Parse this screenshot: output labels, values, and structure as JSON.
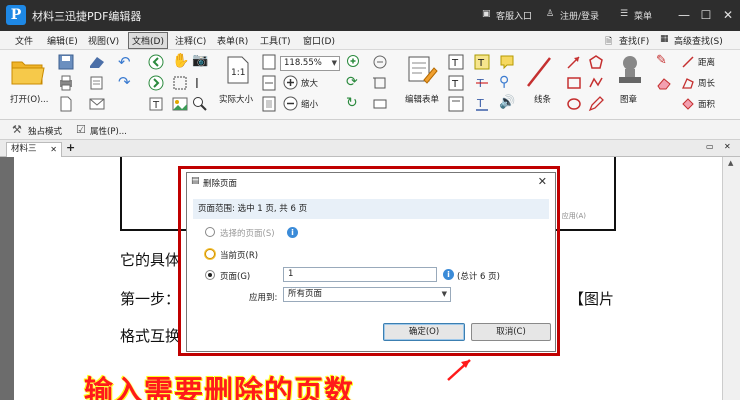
{
  "app": {
    "title": "材料三迅捷PDF编辑器",
    "logo_letter": "P",
    "service": "客服入口",
    "login": "注册/登录",
    "menu": "菜单"
  },
  "menubar": {
    "items": [
      "文件",
      "编辑(E)",
      "视图(V)",
      "文档(D)",
      "注释(C)",
      "表单(R)",
      "工具(T)",
      "窗口(D)"
    ],
    "active_index": 3,
    "find": "查找(F)",
    "advanced_find": "高级查找(S)"
  },
  "ribbon": {
    "open": "打开(O)...",
    "actual_size": "实际大小",
    "zoom_value": "118.55%",
    "zoom_in": "放大",
    "zoom_out": "缩小",
    "edit_form": "编辑表单",
    "lines": "线条",
    "stamp": "图章",
    "distance": "距离",
    "perimeter": "周长",
    "area": "面积"
  },
  "subtoolbar": {
    "exclusive_mode": "独占模式",
    "properties": "属性(P)..."
  },
  "tabs": {
    "doc_tab": "材料三"
  },
  "document": {
    "line1": "它的具体",
    "line2": "第一步：",
    "line2_right": "【图片",
    "line3": "格式互换",
    "apply_hint": "应用(A)"
  },
  "dialog": {
    "title": "删除页面",
    "range_text": "页面范围: 选中 1 页, 共 6 页",
    "opt_selected": "选择的页面(S)",
    "opt_current": "当前页(R)",
    "opt_pages": "页面(G)",
    "pages_value": "1",
    "total_text": "(总计 6 页)",
    "apply_to_label": "应用到:",
    "apply_to_value": "所有页面",
    "ok": "确定(O)",
    "cancel": "取消(C)"
  },
  "annotation": {
    "text": "输入需要删除的页数",
    "color": "#ff1a1a"
  }
}
